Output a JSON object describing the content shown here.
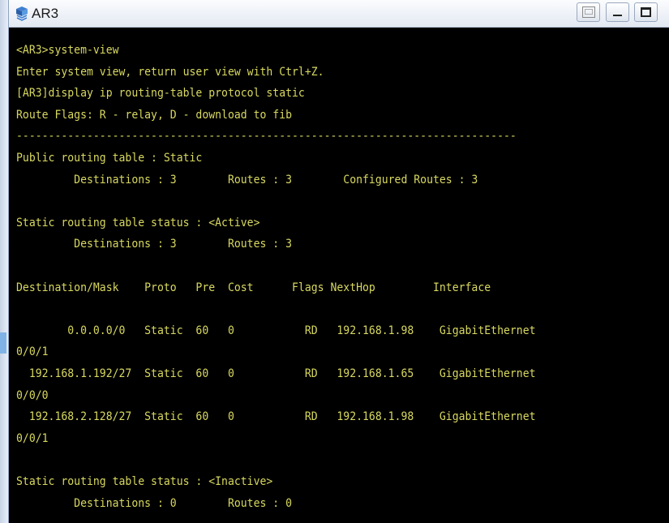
{
  "window": {
    "title": "AR3",
    "icons": {
      "app": "router-icon",
      "restore": "restore-icon",
      "minimize": "minimize-icon",
      "maximize": "maximize-icon"
    }
  },
  "terminal": {
    "text_color": "#d8d860",
    "background": "#000000",
    "lines": [
      "<AR3>system-view",
      "Enter system view, return user view with Ctrl+Z.",
      "[AR3]display ip routing-table protocol static",
      "Route Flags: R - relay, D - download to fib",
      "------------------------------------------------------------------------------",
      "Public routing table : Static",
      "         Destinations : 3        Routes : 3        Configured Routes : 3",
      "",
      "Static routing table status : <Active>",
      "         Destinations : 3        Routes : 3",
      "",
      "Destination/Mask    Proto   Pre  Cost      Flags NextHop         Interface",
      "",
      "        0.0.0.0/0   Static  60   0           RD   192.168.1.98    GigabitEthernet",
      "0/0/1",
      "  192.168.1.192/27  Static  60   0           RD   192.168.1.65    GigabitEthernet",
      "0/0/0",
      "  192.168.2.128/27  Static  60   0           RD   192.168.1.98    GigabitEthernet",
      "0/0/1",
      "",
      "Static routing table status : <Inactive>",
      "         Destinations : 0        Routes : 0"
    ]
  }
}
